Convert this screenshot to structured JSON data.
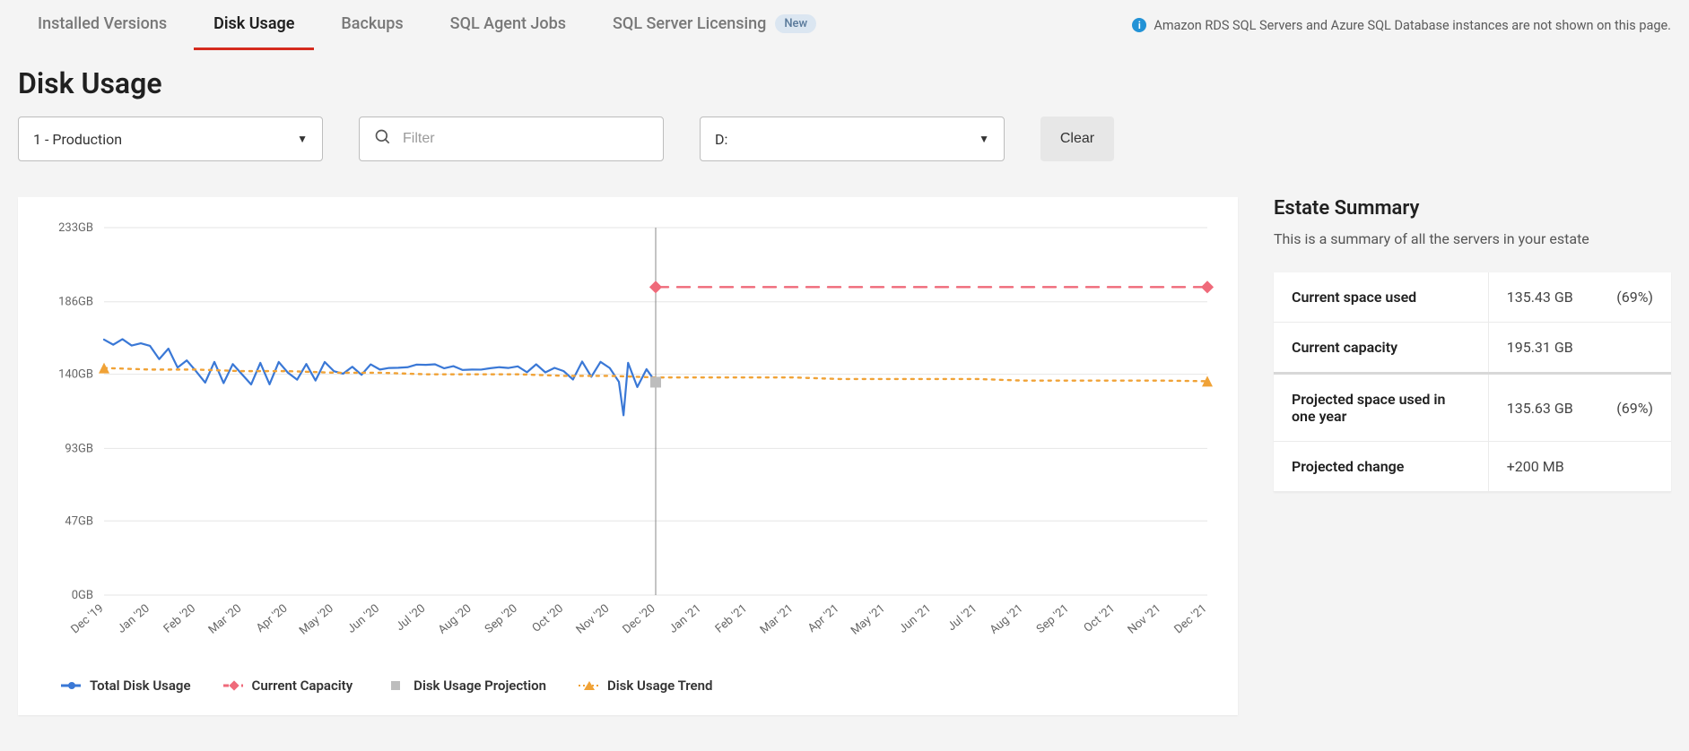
{
  "tabs": {
    "installed": "Installed Versions",
    "disk": "Disk Usage",
    "backups": "Backups",
    "jobs": "SQL Agent Jobs",
    "licensing": "SQL Server Licensing",
    "new_badge": "New"
  },
  "banner": {
    "text": "Amazon RDS SQL Servers and Azure SQL Database instances are not shown on this page."
  },
  "page_title": "Disk Usage",
  "filters": {
    "env": "1 - Production",
    "filter_placeholder": "Filter",
    "drive": "D:",
    "clear": "Clear"
  },
  "summary": {
    "title": "Estate Summary",
    "subtitle": "This is a summary of all the servers in your estate",
    "rows": {
      "current_used_label": "Current space used",
      "current_used_val": "135.43 GB",
      "current_used_pct": "(69%)",
      "current_cap_label": "Current capacity",
      "current_cap_val": "195.31 GB",
      "proj_used_label": "Projected space used in one year",
      "proj_used_val": "135.63 GB",
      "proj_used_pct": "(69%)",
      "proj_change_label": "Projected change",
      "proj_change_val": "+200 MB"
    }
  },
  "legend": {
    "total": "Total Disk Usage",
    "capacity": "Current Capacity",
    "projection": "Disk Usage Projection",
    "trend": "Disk Usage Trend"
  },
  "chart_data": {
    "type": "line",
    "ylabel": "GB",
    "ylim": [
      0,
      233
    ],
    "y_ticks": [
      "0GB",
      "47GB",
      "93GB",
      "140GB",
      "186GB",
      "233GB"
    ],
    "x_ticks": [
      "Dec '19",
      "Jan '20",
      "Feb '20",
      "Mar '20",
      "Apr '20",
      "May '20",
      "Jun '20",
      "Jul '20",
      "Aug '20",
      "Sep '20",
      "Oct '20",
      "Nov '20",
      "Dec '20",
      "Jan '21",
      "Feb '21",
      "Mar '21",
      "Apr '21",
      "May '21",
      "Jun '21",
      "Jul '21",
      "Aug '21",
      "Sep '21",
      "Oct '21",
      "Nov '21",
      "Dec '21"
    ],
    "now_index": 12,
    "series": [
      {
        "name": "Total Disk Usage",
        "color": "#3a78d6",
        "style": "solid",
        "x": [
          "Dec '19",
          "Jan '20",
          "Feb '20",
          "Mar '20",
          "Apr '20",
          "May '20",
          "Jun '20",
          "Jul '20",
          "Aug '20",
          "Sep '20",
          "Oct '20",
          "Nov '20",
          "Dec '20"
        ],
        "values": [
          162,
          158,
          142,
          140,
          141,
          142,
          143,
          146,
          143,
          145,
          142,
          144,
          135
        ]
      },
      {
        "name": "Current Capacity",
        "color": "#ef6a7a",
        "style": "dashed",
        "x": [
          "Dec '20",
          "Jan '21",
          "Feb '21",
          "Mar '21",
          "Apr '21",
          "May '21",
          "Jun '21",
          "Jul '21",
          "Aug '21",
          "Sep '21",
          "Oct '21",
          "Nov '21",
          "Dec '21"
        ],
        "values": [
          195.31,
          195.31,
          195.31,
          195.31,
          195.31,
          195.31,
          195.31,
          195.31,
          195.31,
          195.31,
          195.31,
          195.31,
          195.31
        ]
      },
      {
        "name": "Disk Usage Trend",
        "color": "#f0a236",
        "style": "dotted",
        "x": [
          "Dec '19",
          "Jan '20",
          "Feb '20",
          "Mar '20",
          "Apr '20",
          "May '20",
          "Jun '20",
          "Jul '20",
          "Aug '20",
          "Sep '20",
          "Oct '20",
          "Nov '20",
          "Dec '20",
          "Jan '21",
          "Feb '21",
          "Mar '21",
          "Apr '21",
          "May '21",
          "Jun '21",
          "Jul '21",
          "Aug '21",
          "Sep '21",
          "Oct '21",
          "Nov '21",
          "Dec '21"
        ],
        "values": [
          144,
          143,
          143,
          142,
          142,
          141,
          141,
          140,
          140,
          140,
          139,
          139,
          138,
          138,
          138,
          138,
          137,
          137,
          137,
          137,
          136,
          136,
          136,
          136,
          135.6
        ]
      },
      {
        "name": "Disk Usage Projection",
        "color": "#bdbdbd",
        "style": "marker",
        "x": [
          "Dec '20"
        ],
        "values": [
          135
        ]
      }
    ]
  }
}
